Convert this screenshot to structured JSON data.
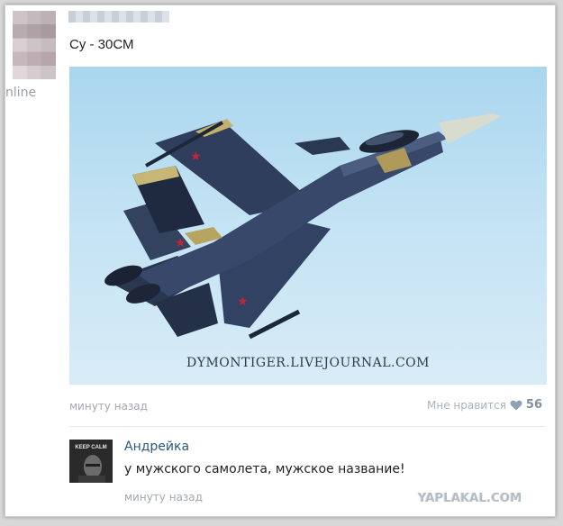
{
  "post": {
    "title": "Су - 30СМ",
    "online_label": "nline",
    "photo_watermark": "DYMONTIGER.LIVEJOURNAL.COM",
    "time": "минуту назад",
    "likes": {
      "label": "Мне нравится",
      "count": "56"
    }
  },
  "comment": {
    "author": "Андрейка",
    "avatar_text": "KEEP CALM",
    "text": "у мужского самолета, мужское название!",
    "time": "минуту назад"
  },
  "site_watermark": "YAPLAKAL.COM",
  "colors": {
    "link": "#2b587a",
    "meta": "#a3a8ad",
    "sky": "#bfe0f2",
    "jet": "#2c3b55"
  }
}
